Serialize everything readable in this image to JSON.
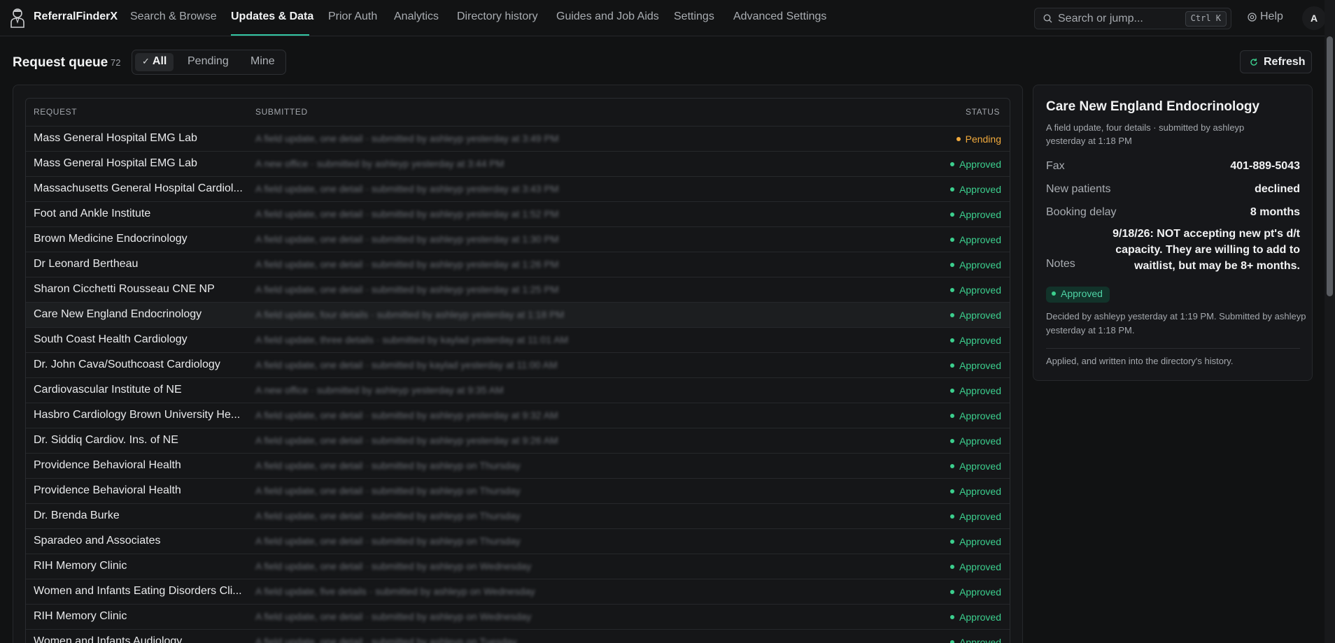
{
  "app": {
    "title": "ReferralFinderX",
    "avatar": "A"
  },
  "nav": {
    "items": [
      {
        "label": "Search & Browse",
        "active": false
      },
      {
        "label": "Updates & Data",
        "active": true
      },
      {
        "label": "Prior Auth",
        "active": false
      },
      {
        "label": "Analytics",
        "active": false
      },
      {
        "label": "Directory history",
        "active": false
      },
      {
        "label": "Guides and Job Aids",
        "active": false
      },
      {
        "label": "Settings",
        "active": false
      },
      {
        "label": "Advanced Settings",
        "active": false
      }
    ],
    "search_placeholder": "Search or jump...",
    "search_shortcut": "Ctrl K",
    "help": "Help"
  },
  "queue": {
    "title": "Request queue",
    "count": "72",
    "filters": [
      "All",
      "Pending",
      "Mine"
    ],
    "active_filter": "All",
    "refresh": "Refresh",
    "columns": {
      "request": "REQUEST",
      "submitted": "SUBMITTED",
      "status": "STATUS"
    },
    "rows": [
      {
        "name": "Mass General Hospital EMG Lab",
        "submitted": "A field update, one detail · submitted by ashleyp yesterday at 3:49 PM",
        "status": "Pending"
      },
      {
        "name": "Mass General Hospital EMG Lab",
        "submitted": "A new office · submitted by ashleyp yesterday at 3:44 PM",
        "status": "Approved"
      },
      {
        "name": "Massachusetts General Hospital Cardiol...",
        "submitted": "A field update, one detail · submitted by ashleyp yesterday at 3:43 PM",
        "status": "Approved"
      },
      {
        "name": "Foot and Ankle Institute",
        "submitted": "A field update, one detail · submitted by ashleyp yesterday at 1:52 PM",
        "status": "Approved"
      },
      {
        "name": "Brown Medicine Endocrinology",
        "submitted": "A field update, one detail · submitted by ashleyp yesterday at 1:30 PM",
        "status": "Approved"
      },
      {
        "name": "Dr Leonard Bertheau",
        "submitted": "A field update, one detail · submitted by ashleyp yesterday at 1:26 PM",
        "status": "Approved"
      },
      {
        "name": "Sharon Cicchetti Rousseau CNE NP",
        "submitted": "A field update, one detail · submitted by ashleyp yesterday at 1:25 PM",
        "status": "Approved"
      },
      {
        "name": "Care New England Endocrinology",
        "submitted": "A field update, four details · submitted by ashleyp yesterday at 1:18 PM",
        "status": "Approved",
        "selected": true
      },
      {
        "name": "South Coast Health Cardiology",
        "submitted": "A field update, three details · submitted by kaylad yesterday at 11:01 AM",
        "status": "Approved"
      },
      {
        "name": "Dr. John Cava/Southcoast Cardiology",
        "submitted": "A field update, one detail · submitted by kaylad yesterday at 11:00 AM",
        "status": "Approved"
      },
      {
        "name": "Cardiovascular Institute of NE",
        "submitted": "A new office · submitted by ashleyp yesterday at 9:35 AM",
        "status": "Approved"
      },
      {
        "name": "Hasbro Cardiology Brown University He...",
        "submitted": "A field update, one detail · submitted by ashleyp yesterday at 9:32 AM",
        "status": "Approved"
      },
      {
        "name": "Dr. Siddiq Cardiov. Ins. of NE",
        "submitted": "A field update, one detail · submitted by ashleyp yesterday at 9:26 AM",
        "status": "Approved"
      },
      {
        "name": "Providence Behavioral Health",
        "submitted": "A field update, one detail · submitted by ashleyp on Thursday",
        "status": "Approved"
      },
      {
        "name": "Providence Behavioral Health",
        "submitted": "A field update, one detail · submitted by ashleyp on Thursday",
        "status": "Approved"
      },
      {
        "name": "Dr. Brenda Burke",
        "submitted": "A field update, one detail · submitted by ashleyp on Thursday",
        "status": "Approved"
      },
      {
        "name": "Sparadeo and Associates",
        "submitted": "A field update, one detail · submitted by ashleyp on Thursday",
        "status": "Approved"
      },
      {
        "name": "RIH Memory Clinic",
        "submitted": "A field update, one detail · submitted by ashleyp on Wednesday",
        "status": "Approved"
      },
      {
        "name": "Women and Infants Eating Disorders Cli...",
        "submitted": "A field update, five details · submitted by ashleyp on Wednesday",
        "status": "Approved"
      },
      {
        "name": "RIH Memory Clinic",
        "submitted": "A field update, one detail · submitted by ashleyp on Wednesday",
        "status": "Approved"
      },
      {
        "name": "Women and Infants Audiology",
        "submitted": "A field update, one detail · submitted by ashleyp on Tuesday",
        "status": "Approved"
      }
    ]
  },
  "detail": {
    "title": "Care New England Endocrinology",
    "subtitle": "A field update, four details · submitted by ashleyp yesterday at 1:18 PM",
    "fields": [
      {
        "label": "Fax",
        "value": "401-889-5043"
      },
      {
        "label": "New patients",
        "value": "declined"
      },
      {
        "label": "Booking delay",
        "value": "8 months"
      }
    ],
    "notes_label": "Notes",
    "notes_value": "9/18/26: NOT accepting new pt's d/t capacity. They are willing to add to waitlist, but may be 8+ months.",
    "status": "Approved",
    "decided": "Decided by ashleyp yesterday at 1:19 PM. Submitted by ashleyp yesterday at 1:18 PM.",
    "applied": "Applied, and written into the directory's history."
  },
  "colors": {
    "approved": "#3ccf8e",
    "pending": "#f0a93c",
    "accent": "#34c6a3"
  },
  "icons": {
    "logo": "doctor-logo-icon",
    "search": "search-icon",
    "help": "help-icon",
    "check": "check-icon",
    "refresh": "refresh-icon"
  }
}
